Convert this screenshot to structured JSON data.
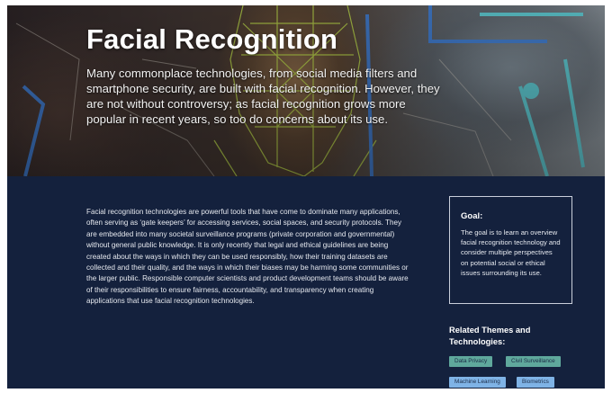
{
  "hero": {
    "title": "Facial Recognition",
    "description": "Many commonplace technologies, from social media filters and smartphone security, are built with facial recognition. However, they are not without controversy; as facial recognition grows more popular in recent years, so too do concerns about its use."
  },
  "body": {
    "paragraph": "Facial recognition technologies are powerful tools that have come to dominate many applications, often serving as ‘gate keepers’ for accessing services, social spaces, and security protocols. They are embedded into many societal surveillance programs (private corporation and governmental) without general public knowledge. It is only recently that legal and ethical guidelines are being created about the ways in which they can be used responsibly, how their training datasets are collected and their quality, and the ways in which their biases may be harming some communities or the larger public. Responsible computer scientists and product development teams should be aware of their responsibilities to ensure fairness, accountability, and transparency when creating applications that use facial recognition technologies."
  },
  "goal": {
    "title": "Goal:",
    "text": "The goal is to learn an overview facial recognition technology and consider multiple perspectives on potential social or ethical issues surrounding its use."
  },
  "related": {
    "heading": "Related Themes and Technologies:",
    "tags": [
      {
        "label": "Data Privacy",
        "color": "#5fa89c"
      },
      {
        "label": "Civil Surveillance",
        "color": "#5fa89c"
      },
      {
        "label": "Machine Learning",
        "color": "#7fb3e6"
      },
      {
        "label": "Biometrics",
        "color": "#7fb3e6"
      }
    ]
  },
  "colors": {
    "page_background": "#14213d",
    "theme_tag": "#5fa89c",
    "technology_tag": "#7fb3e6"
  }
}
